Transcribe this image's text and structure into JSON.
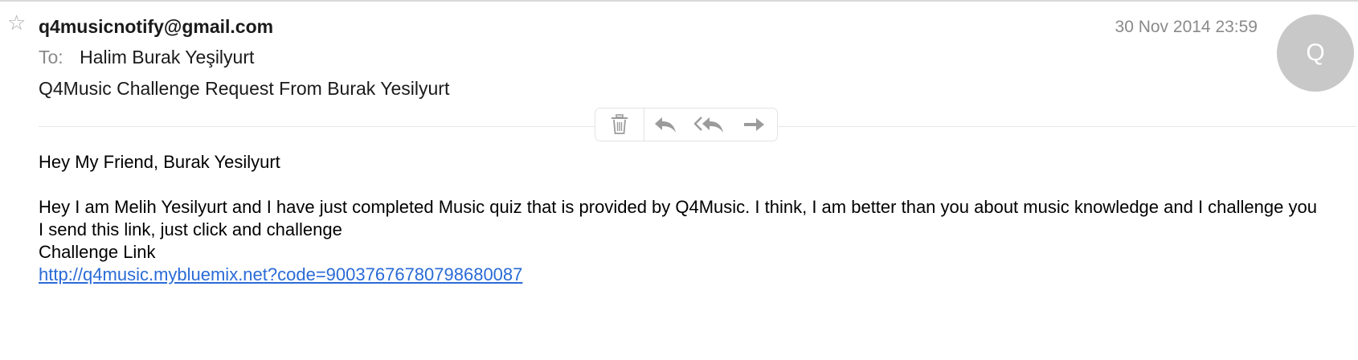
{
  "message": {
    "star_glyph": "☆",
    "from": "q4musicnotify@gmail.com",
    "date": "30 Nov 2014 23:59",
    "avatar_initial": "Q",
    "to_label": "To:",
    "to_name": "Halim Burak Yeşilyurt",
    "subject": "Q4Music Challenge Request From Burak Yesilyurt"
  },
  "toolbar": {
    "icons": [
      "trash-icon",
      "reply-icon",
      "reply-all-icon",
      "forward-icon"
    ]
  },
  "body": {
    "greeting": "Hey My Friend, Burak Yesilyurt",
    "paragraph": "Hey I am Melih Yesilyurt and I have just completed Music quiz that is provided by Q4Music. I think, I am better than you about music knowledge and I challenge you",
    "line2": "I send this link, just click and challenge",
    "line3": "Challenge Link",
    "link": "http://q4music.mybluemix.net?code=9003767678079868​0087"
  },
  "colors": {
    "link": "#2a6bd6",
    "meta_gray": "#8a8a8a",
    "avatar_bg": "#c8c8c8",
    "icon_gray": "#9b9b9b"
  }
}
